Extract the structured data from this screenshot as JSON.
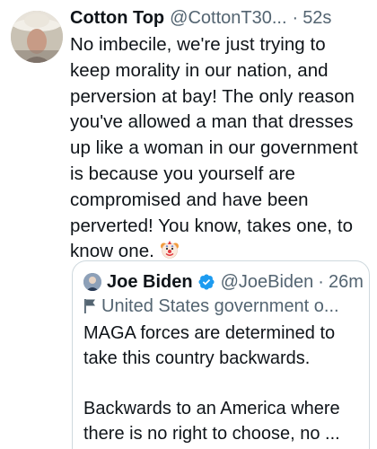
{
  "tweet": {
    "display_name": "Cotton Top",
    "handle": "@CottonT30...",
    "separator": "·",
    "time": "52s",
    "text_lines": [
      "No imbecile, we're just trying to",
      "keep morality in our nation, and",
      "perversion at bay! The only reason",
      "you've allowed a man that dresses",
      "up like a woman in our government",
      "is because you yourself are",
      "compromised and have been",
      "perverted! You know, takes one, to",
      "know one."
    ],
    "emoji": "clown-face-icon"
  },
  "quote": {
    "display_name": "Joe Biden",
    "handle": "@JoeBiden",
    "separator": "·",
    "time": "26m",
    "label": "United States government o...",
    "text_lines": [
      "MAGA forces are determined to",
      "take this country backwards."
    ],
    "text_lines_2": [
      "Backwards to an America where",
      "there is no right to choose, no ..."
    ]
  },
  "colors": {
    "text": "#0f1419",
    "secondary": "#536471",
    "border": "#cfd9de",
    "verified": "#1d9bf0"
  }
}
